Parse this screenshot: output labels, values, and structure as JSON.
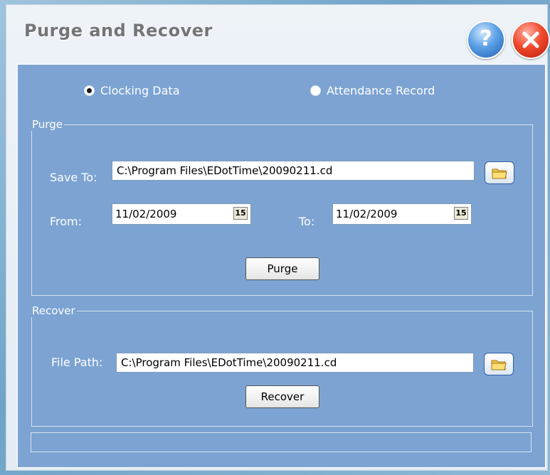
{
  "window": {
    "title": "Purge and Recover"
  },
  "title_buttons": {
    "help_symbol": "?"
  },
  "mode": {
    "options": [
      {
        "label": "Clocking Data",
        "selected": true
      },
      {
        "label": "Attendance Record",
        "selected": false
      }
    ]
  },
  "purge": {
    "legend": "Purge",
    "save_to_label": "Save To:",
    "save_to_value": "C:\\Program Files\\EDotTime\\20090211.cd",
    "from_label": "From:",
    "from_value": "11/02/2009",
    "to_label": "To:",
    "to_value": "11/02/2009",
    "calendar_icon_text": "15",
    "button_label": "Purge"
  },
  "recover": {
    "legend": "Recover",
    "file_path_label": "File Path:",
    "file_path_value": "C:\\Program Files\\EDotTime\\20090211.cd",
    "button_label": "Recover"
  },
  "status": {
    "text": ""
  }
}
